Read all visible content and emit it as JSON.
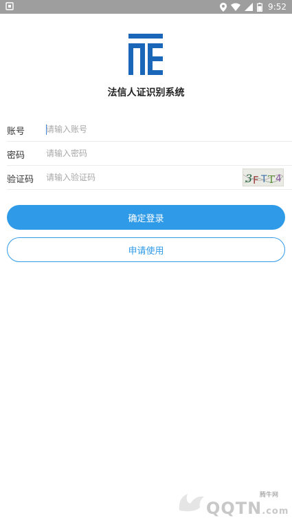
{
  "status_bar": {
    "time": "9:52",
    "icons": [
      "notification-icon",
      "location-icon",
      "wifi-icon",
      "signal-icon",
      "battery-icon"
    ]
  },
  "app": {
    "title": "法信人证识别系统",
    "logo": "fx-logo",
    "brand_color": "#2f9be8",
    "logo_color": "#1a66b8"
  },
  "form": {
    "account": {
      "label": "账号",
      "placeholder": "请输入账号"
    },
    "password": {
      "label": "密码",
      "placeholder": "请输入密码"
    },
    "captcha": {
      "label": "验证码",
      "placeholder": "请输入验证码",
      "image_text": "3FTT4"
    }
  },
  "buttons": {
    "login": "确定登录",
    "apply": "申请使用"
  },
  "watermark": {
    "site": "腾牛网",
    "brand": "QQTN",
    "suffix": ".com"
  }
}
